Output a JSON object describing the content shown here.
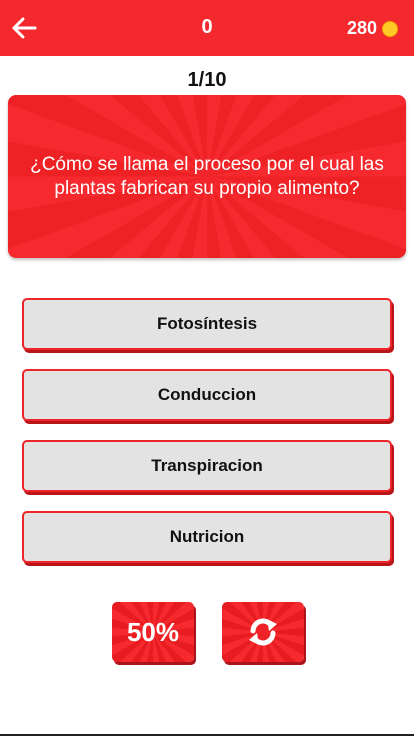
{
  "header": {
    "score": "0",
    "coins": "280",
    "back_icon": "arrow-left-icon",
    "coin_icon": "coin-icon",
    "bar_color": "#f4292d"
  },
  "progress": "1/10",
  "question": {
    "text": "¿Cómo se llama el proceso por el cual las plantas fabrican su propio alimento?"
  },
  "answers": [
    {
      "label": "Fotosíntesis"
    },
    {
      "label": "Conduccion"
    },
    {
      "label": "Transpiracion"
    },
    {
      "label": "Nutricion"
    }
  ],
  "lifelines": {
    "fifty_label": "50%",
    "refresh_icon": "refresh-icon"
  },
  "colors": {
    "accent": "#f4292d",
    "answer_bg": "#e3e3e3",
    "coin": "#ffc928"
  }
}
